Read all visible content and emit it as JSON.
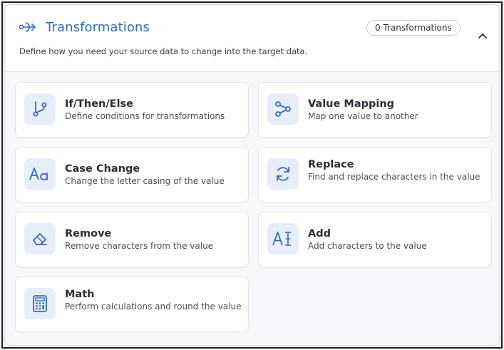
{
  "header": {
    "title": "Transformations",
    "count_label": "0 Transformations",
    "subtitle": "Define how you need your source data to change into the target data."
  },
  "cards": [
    {
      "title": "If/Then/Else",
      "description": "Define conditions for transformations",
      "icon": "branch-icon"
    },
    {
      "title": "Value Mapping",
      "description": "Map one value to another",
      "icon": "share-nodes-icon"
    },
    {
      "title": "Case Change",
      "description": "Change the letter casing of the value",
      "icon": "text-case-icon"
    },
    {
      "title": "Replace",
      "description": "Find and replace characters in the value",
      "icon": "refresh-icon"
    },
    {
      "title": "Remove",
      "description": "Remove characters from the value",
      "icon": "eraser-icon"
    },
    {
      "title": "Add",
      "description": "Add characters to the value",
      "icon": "text-cursor-icon"
    },
    {
      "title": "Math",
      "description": "Perform calculations and round the value",
      "icon": "calculator-icon"
    }
  ],
  "colors": {
    "accent": "#2f6cbf",
    "icon_bg": "#e7eefa",
    "panel_bg": "#f6f8fb"
  }
}
